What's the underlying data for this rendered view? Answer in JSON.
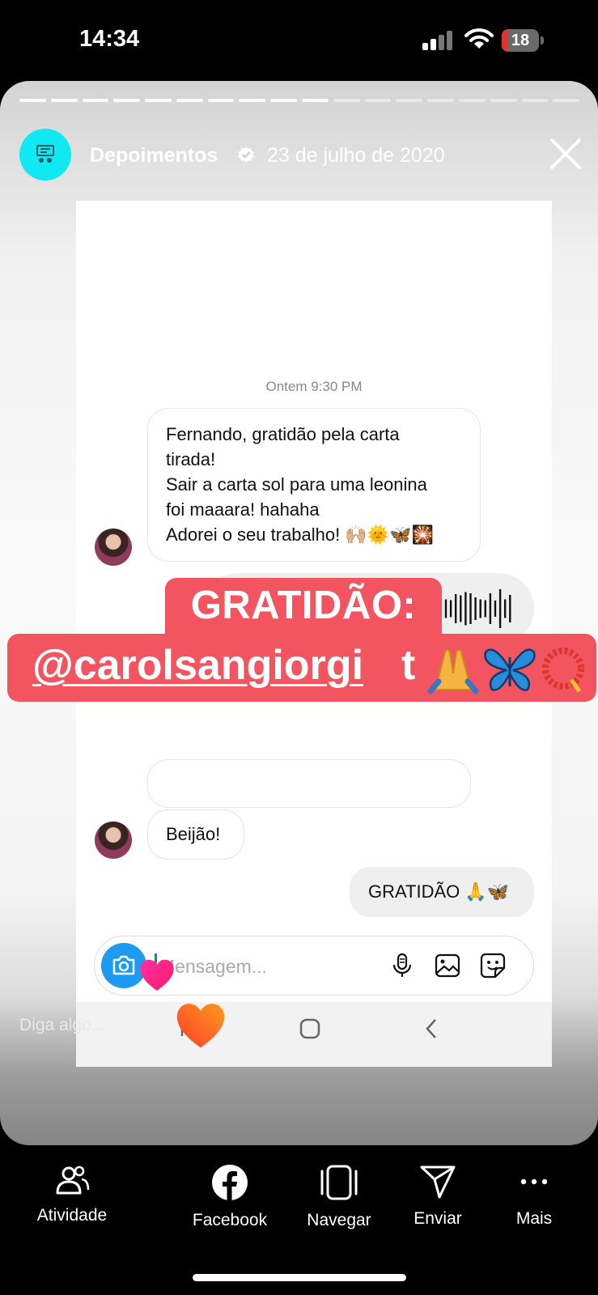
{
  "status_bar": {
    "time": "14:34",
    "battery": "18",
    "battery_level": 0.18
  },
  "story": {
    "account_name": "Depoimentos",
    "verified": true,
    "date": "23 de julho de 2020",
    "close_icon": "close-icon",
    "progress_segments": 18,
    "progress_active": 10,
    "reply_placeholder": "Diga algo..."
  },
  "chat": {
    "timestamp": "Ontem 9:30 PM",
    "message_1_lines": [
      "Fernando, gratidão pela carta",
      "tirada!",
      "Sair a carta sol para uma leonina",
      "foi maaara! hahaha",
      "Adorei o seu trabalho! 🙌🏼🌞🦋🎇"
    ],
    "message_2": "Beijão!",
    "message_3": "GRATIDÃO 🙏🦋",
    "composer_placeholder": "Mensagem..."
  },
  "sticker": {
    "line_1": "GRATIDÃO:",
    "mention": "@carolsangiorgi",
    "suffix": "t",
    "emojis": [
      "🙏",
      "🦋",
      "📿"
    ]
  },
  "actions": [
    {
      "label": "Atividade",
      "icon": "activity-icon"
    },
    {
      "label": "Facebook",
      "icon": "facebook-icon"
    },
    {
      "label": "Navegar",
      "icon": "browse-icon"
    },
    {
      "label": "Enviar",
      "icon": "send-icon"
    },
    {
      "label": "Mais",
      "icon": "more-icon"
    }
  ],
  "colors": {
    "sticker": "#f2555f",
    "avatar": "#10e8f2",
    "camera_button": "#1d9bf0",
    "battery_low": "#e0352b"
  }
}
